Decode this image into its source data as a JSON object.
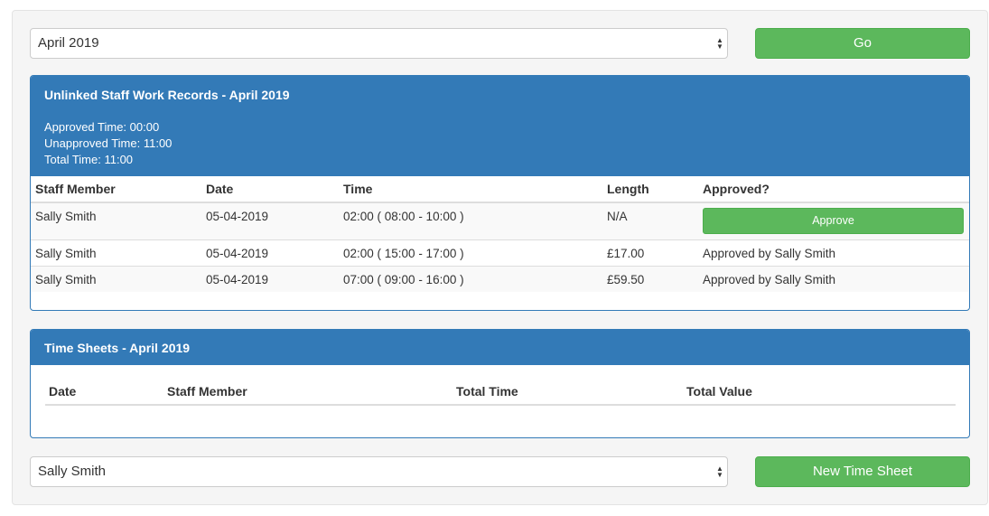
{
  "month_select": {
    "value": "April 2019",
    "arrows": "▲▼"
  },
  "go_button": {
    "label": "Go"
  },
  "unlinked_panel": {
    "title": "Unlinked Staff Work Records - April 2019",
    "approved_time": "Approved Time: 00:00",
    "unapproved_time": "Unapproved Time: 11:00",
    "total_time": "Total Time: 11:00",
    "columns": [
      "Staff Member",
      "Date",
      "Time",
      "Length",
      "Approved?"
    ],
    "rows": [
      {
        "staff": "Sally Smith",
        "date": "05-04-2019",
        "time": "02:00 ( 08:00 - 10:00 )",
        "length": "N/A",
        "approved": "",
        "approve_label": "Approve"
      },
      {
        "staff": "Sally Smith",
        "date": "05-04-2019",
        "time": "02:00 ( 15:00 - 17:00 )",
        "length": "£17.00",
        "approved": "Approved by Sally Smith"
      },
      {
        "staff": "Sally Smith",
        "date": "05-04-2019",
        "time": "07:00 ( 09:00 - 16:00 )",
        "length": "£59.50",
        "approved": "Approved by Sally Smith"
      }
    ]
  },
  "timesheets_panel": {
    "title": "Time Sheets - April 2019",
    "columns": [
      "Date",
      "Staff Member",
      "Total Time",
      "Total Value"
    ]
  },
  "staff_select": {
    "value": "Sally Smith",
    "arrows": "▲▼"
  },
  "new_timesheet_button": {
    "label": "New Time Sheet"
  },
  "colors": {
    "primary": "#337ab7",
    "success": "#5cb85c",
    "well": "#f5f5f5"
  }
}
